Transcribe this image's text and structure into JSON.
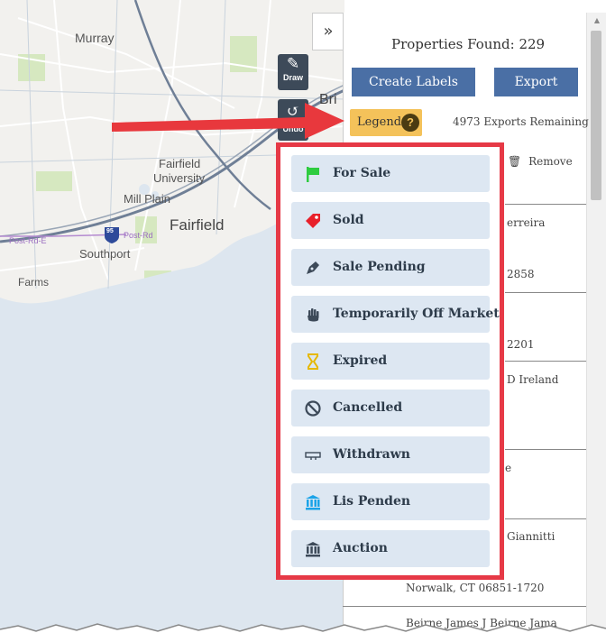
{
  "map": {
    "places": [
      "Murray",
      "Fairfield",
      "University",
      "Mill Plain",
      "Fairfield",
      "Southport",
      "Farms",
      "Bri"
    ],
    "roads": [
      "Post-Rd-E",
      "Post-Rd"
    ],
    "highway_shield": "95",
    "tools": [
      {
        "label": "Draw",
        "icon": "pencil-icon",
        "glyph": "✎"
      },
      {
        "label": "Undo",
        "icon": "undo-icon",
        "glyph": "↺"
      }
    ],
    "collapse_glyph": "»"
  },
  "panel": {
    "properties_found": "Properties Found: 229",
    "create_labels": "Create Labels",
    "export": "Export",
    "legend": "Legend",
    "help_glyph": "?",
    "exports_remaining": "4973 Exports Remaining",
    "remove": "Remove",
    "remove_glyph": "🗑",
    "partial_rows": [
      "erreira",
      "2858",
      "2201",
      "D Ireland",
      "e",
      "Giannitti",
      "Norwalk, CT 06851-1720",
      "Beirne James J Beirne Jama"
    ]
  },
  "legend_items": [
    {
      "label": "For Sale",
      "icon": "for-sale-flag-icon",
      "color": "#2ecc40"
    },
    {
      "label": "Sold",
      "icon": "sold-tag-icon",
      "color": "#e8202a"
    },
    {
      "label": "Sale Pending",
      "icon": "pen-nib-icon",
      "color": "#3d4a59"
    },
    {
      "label": "Temporarily Off Market",
      "icon": "hand-icon",
      "color": "#3d4a59"
    },
    {
      "label": "Expired",
      "icon": "hourglass-icon",
      "color": "#e6b800"
    },
    {
      "label": "Cancelled",
      "icon": "ban-icon",
      "color": "#3d4a59"
    },
    {
      "label": "Withdrawn",
      "icon": "withdrawn-sign-icon",
      "color": "#3d4a59"
    },
    {
      "label": "Lis Penden",
      "icon": "bank-blue-icon",
      "color": "#1aa3e8"
    },
    {
      "label": "Auction",
      "icon": "bank-dark-icon",
      "color": "#3d4a59"
    }
  ],
  "colors": {
    "accent_button": "#4a6fa5",
    "legend_button": "#f4c25a",
    "highlight": "#e63946",
    "legend_item_bg": "#dde7f2",
    "water": "#dde6ef"
  }
}
